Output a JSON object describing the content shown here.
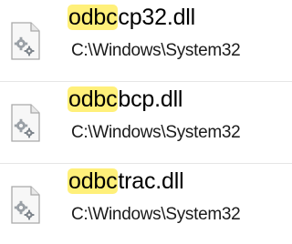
{
  "results": [
    {
      "match": "odbc",
      "rest": "cp32.dll",
      "path": "C:\\Windows\\System32",
      "icon": "dll-file-icon"
    },
    {
      "match": "odbc",
      "rest": "bcp.dll",
      "path": "C:\\Windows\\System32",
      "icon": "dll-file-icon"
    },
    {
      "match": "odbc",
      "rest": "trac.dll",
      "path": "C:\\Windows\\System32",
      "icon": "dll-file-icon"
    }
  ],
  "colors": {
    "highlight": "#fff07a",
    "divider": "#e6e6e6"
  }
}
